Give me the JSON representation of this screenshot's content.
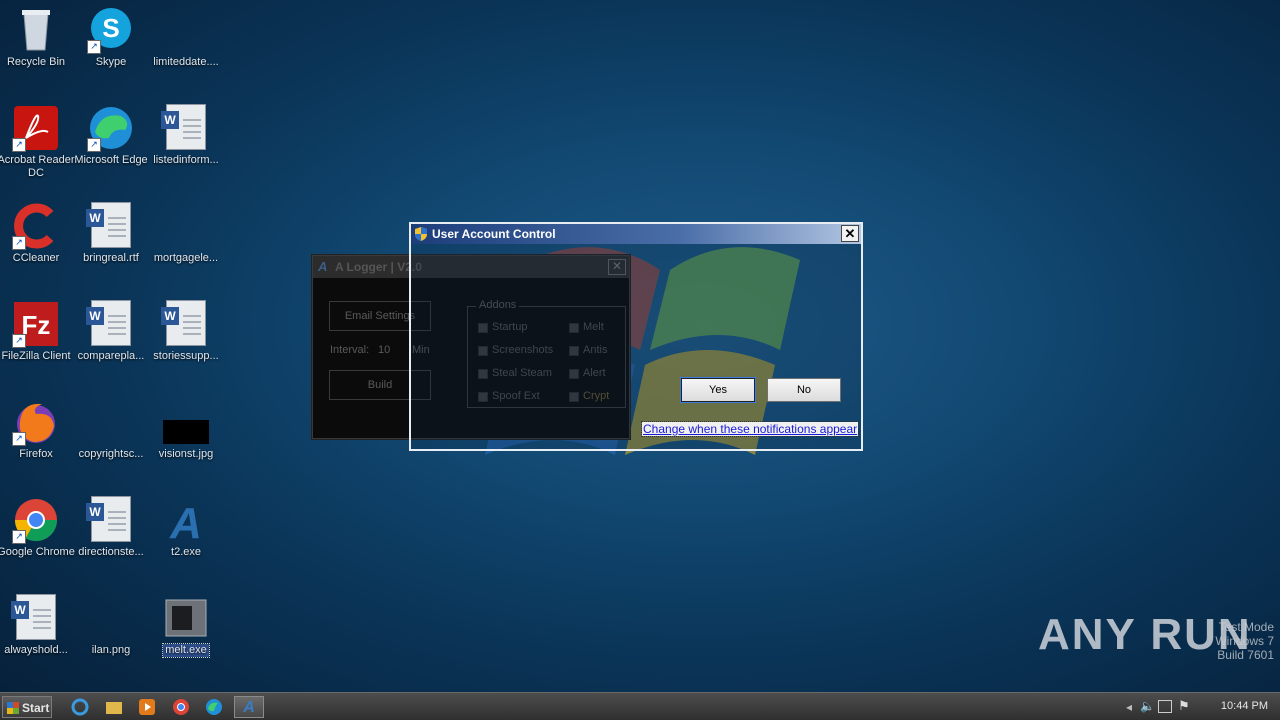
{
  "desktop": {
    "icons": [
      {
        "label": "Recycle Bin",
        "kind": "recycle"
      },
      {
        "label": "Skype",
        "kind": "skype"
      },
      {
        "label": "limiteddate....",
        "kind": "blank"
      },
      {
        "label": "Acrobat Reader DC",
        "kind": "acrobat"
      },
      {
        "label": "Microsoft Edge",
        "kind": "edge"
      },
      {
        "label": "listedinform...",
        "kind": "word"
      },
      {
        "label": "CCleaner",
        "kind": "ccleaner"
      },
      {
        "label": "bringreal.rtf",
        "kind": "word"
      },
      {
        "label": "mortgagele...",
        "kind": "blank"
      },
      {
        "label": "FileZilla Client",
        "kind": "filezilla"
      },
      {
        "label": "comparepla...",
        "kind": "word"
      },
      {
        "label": "storiessupp...",
        "kind": "word"
      },
      {
        "label": "Firefox",
        "kind": "firefox"
      },
      {
        "label": "copyrightsc...",
        "kind": "blank"
      },
      {
        "label": "visionst.jpg",
        "kind": "image"
      },
      {
        "label": "Google Chrome",
        "kind": "chrome"
      },
      {
        "label": "directionste...",
        "kind": "word"
      },
      {
        "label": "t2.exe",
        "kind": "exe-a"
      },
      {
        "label": "alwayshold...",
        "kind": "word"
      },
      {
        "label": "ilan.png",
        "kind": "blank"
      },
      {
        "label": "melt.exe",
        "kind": "melt"
      }
    ]
  },
  "logger": {
    "title": "A Logger | V2.0",
    "email_button": "Email Settings",
    "interval_label": "Interval:",
    "interval_value": "10",
    "interval_unit": "Min",
    "build_button": "Build",
    "addons_legend": "Addons",
    "addons": [
      "Startup",
      "Melt",
      "Screenshots",
      "Antis",
      "Steal Steam",
      "Alert",
      "Spoof Ext",
      "Crypt"
    ],
    "close": "✕"
  },
  "uac": {
    "title": "User Account Control",
    "close": "✕",
    "yes": "Yes",
    "no": "No",
    "link": "Change when these notifications appear"
  },
  "taskbar": {
    "start": "Start",
    "clock": "10:44 PM"
  },
  "watermark": {
    "line1": "Test Mode",
    "line2": "Windows 7",
    "line3": "Build 7601",
    "brand": "ANY RUN"
  }
}
